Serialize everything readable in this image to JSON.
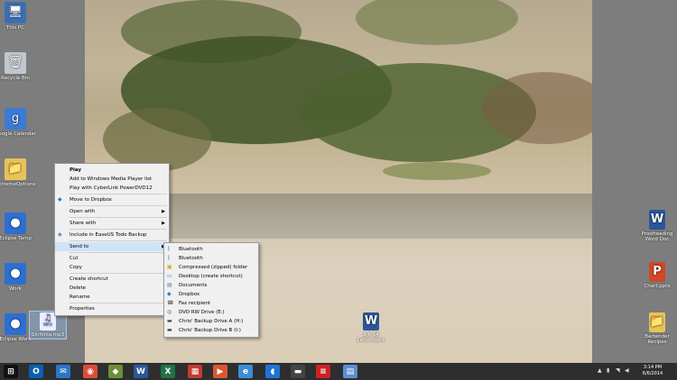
{
  "desktop_left": [
    {
      "label": "This PC",
      "glyph": "🖥",
      "color": "#3b6fb5"
    },
    {
      "label": "Recycle Bin",
      "glyph": "🗑",
      "color": "#c0c7cf"
    },
    {
      "label": "Google Calendar",
      "glyph": "g",
      "color": "#3a7bd5"
    },
    {
      "label": "ExtremeOptions",
      "glyph": "📁",
      "color": "#e7c35a"
    },
    {
      "label": "Eclipse Temp",
      "glyph": "●",
      "color": "#2d6fd1"
    },
    {
      "label": "Work",
      "glyph": "●",
      "color": "#2d6fd1"
    },
    {
      "label": "Eclipse Work",
      "glyph": "●",
      "color": "#2d6fd1"
    }
  ],
  "selected_file": {
    "label": "Sinfonia.mp3",
    "badge": "MP3"
  },
  "desktop_right": [
    {
      "label": "Proofreading Word Doc",
      "glyph": "W",
      "color": "#2b579a"
    },
    {
      "label": "Chart.pptx",
      "glyph": "P",
      "color": "#d24726"
    },
    {
      "label": "Bartender Recipes",
      "glyph": "📁",
      "color": "#e7c35a"
    }
  ],
  "wall_icon": {
    "label": "3-6-14 Letter.docx",
    "glyph": "W"
  },
  "context_menu": {
    "items": [
      {
        "label": "Play",
        "bold": true
      },
      {
        "label": "Add to Windows Media Player list"
      },
      {
        "label": "Play with CyberLink PowerDVD12"
      },
      {
        "sep": true
      },
      {
        "label": "Move to Dropbox",
        "icon": "dropbox"
      },
      {
        "sep": true
      },
      {
        "label": "Open with",
        "submenu": true
      },
      {
        "sep": true
      },
      {
        "label": "Share with",
        "submenu": true
      },
      {
        "sep": true
      },
      {
        "label": "Include in EaseUS Todo Backup",
        "icon": "easeus"
      },
      {
        "sep": true
      },
      {
        "label": "Send to",
        "submenu": true,
        "highlight": true
      },
      {
        "sep": true
      },
      {
        "label": "Cut"
      },
      {
        "label": "Copy"
      },
      {
        "sep": true
      },
      {
        "label": "Create shortcut"
      },
      {
        "label": "Delete"
      },
      {
        "label": "Rename"
      },
      {
        "sep": true
      },
      {
        "label": "Properties"
      }
    ]
  },
  "send_to_menu": {
    "items": [
      {
        "label": "Bluetooth",
        "icon": "bluetooth"
      },
      {
        "label": "Bluetooth",
        "icon": "bluetooth"
      },
      {
        "label": "Compressed (zipped) folder",
        "icon": "zip"
      },
      {
        "label": "Desktop (create shortcut)",
        "icon": "desktop"
      },
      {
        "label": "Documents",
        "icon": "documents"
      },
      {
        "label": "Dropbox",
        "icon": "dropbox"
      },
      {
        "label": "Fax recipient",
        "icon": "fax"
      },
      {
        "label": "DVD RW Drive (E:)",
        "icon": "dvd"
      },
      {
        "label": "Chris' Backup Drive A (H:)",
        "icon": "drive"
      },
      {
        "label": "Chris' Backup Drive B (I:)",
        "icon": "drive"
      }
    ]
  },
  "taskbar": {
    "apps": [
      {
        "name": "start-orb",
        "glyph": "⊞",
        "color": "#111"
      },
      {
        "name": "outlook",
        "glyph": "O",
        "color": "#0b5fb0"
      },
      {
        "name": "thunderbird",
        "glyph": "✉",
        "color": "#2a76c6"
      },
      {
        "name": "chrome",
        "glyph": "◉",
        "color": "#dd4b39"
      },
      {
        "name": "app-tool",
        "glyph": "◆",
        "color": "#6b8f3a"
      },
      {
        "name": "word",
        "glyph": "W",
        "color": "#2b579a"
      },
      {
        "name": "excel",
        "glyph": "X",
        "color": "#217346"
      },
      {
        "name": "calculator",
        "glyph": "▦",
        "color": "#c23b2f"
      },
      {
        "name": "media-player",
        "glyph": "▶",
        "color": "#d9572f"
      },
      {
        "name": "edge",
        "glyph": "e",
        "color": "#3a8ed6"
      },
      {
        "name": "shield",
        "glyph": "◖",
        "color": "#1e73d8"
      },
      {
        "name": "chest",
        "glyph": "▬",
        "color": "#444"
      },
      {
        "name": "ruler",
        "glyph": "≡",
        "color": "#c22"
      },
      {
        "name": "doc",
        "glyph": "▤",
        "color": "#5b8fd1"
      }
    ],
    "clock_time": "3:14 PM",
    "clock_date": "6/6/2014"
  }
}
